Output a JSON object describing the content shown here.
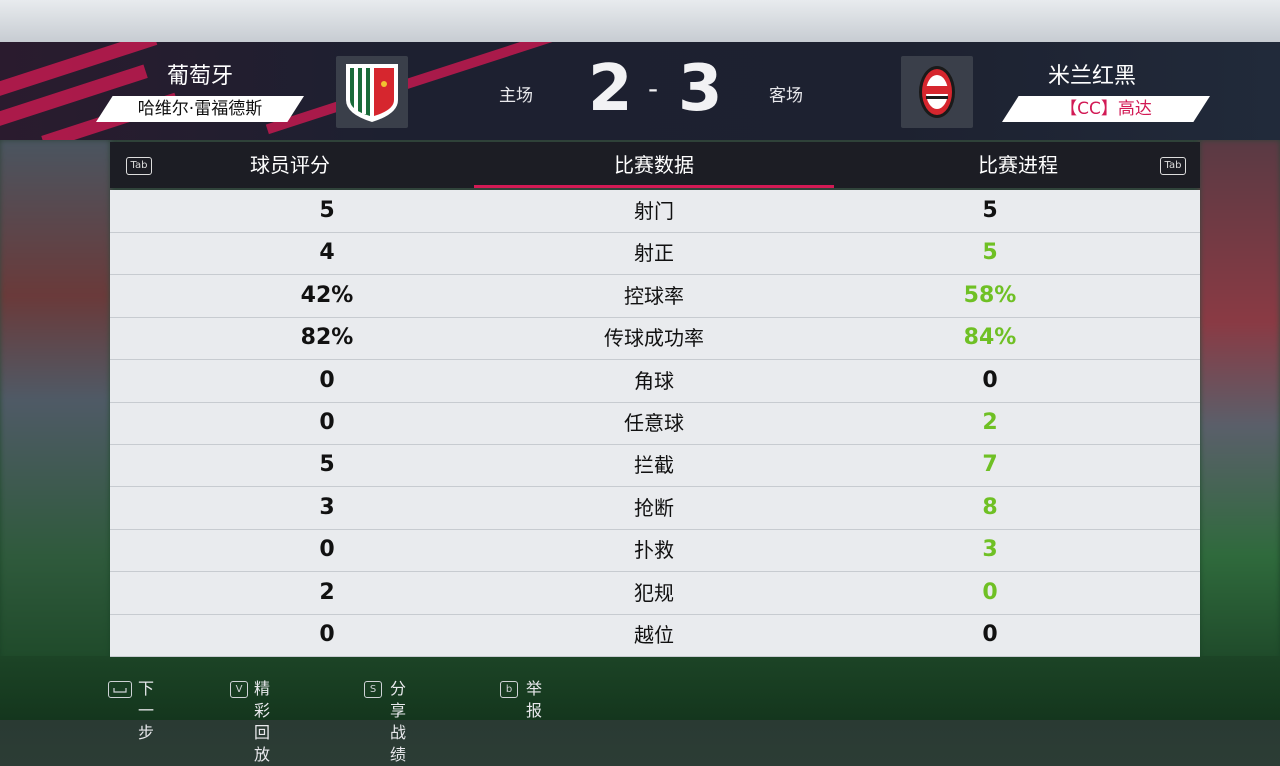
{
  "header": {
    "home_team": "葡萄牙",
    "home_player": "哈维尔·雷福德斯",
    "away_team": "米兰红黑",
    "away_player": "【CC】高达",
    "home_label": "主场",
    "away_label": "客场",
    "home_score": "2",
    "away_score": "3",
    "score_separator": "-"
  },
  "tabs": {
    "left_key": "Tab",
    "right_key": "Tab",
    "items": [
      "球员评分",
      "比赛数据",
      "比赛进程"
    ],
    "active_index": 1
  },
  "stats": [
    {
      "label": "射门",
      "home": "5",
      "away": "5",
      "away_leads": false
    },
    {
      "label": "射正",
      "home": "4",
      "away": "5",
      "away_leads": true
    },
    {
      "label": "控球率",
      "home": "42%",
      "away": "58%",
      "away_leads": true
    },
    {
      "label": "传球成功率",
      "home": "82%",
      "away": "84%",
      "away_leads": true
    },
    {
      "label": "角球",
      "home": "0",
      "away": "0",
      "away_leads": false
    },
    {
      "label": "任意球",
      "home": "0",
      "away": "2",
      "away_leads": true
    },
    {
      "label": "拦截",
      "home": "5",
      "away": "7",
      "away_leads": true
    },
    {
      "label": "抢断",
      "home": "3",
      "away": "8",
      "away_leads": true
    },
    {
      "label": "扑救",
      "home": "0",
      "away": "3",
      "away_leads": true
    },
    {
      "label": "犯规",
      "home": "2",
      "away": "0",
      "away_leads": true
    },
    {
      "label": "越位",
      "home": "0",
      "away": "0",
      "away_leads": false
    }
  ],
  "footer": {
    "items": [
      {
        "key": "",
        "label": "下一步"
      },
      {
        "key": "V",
        "label": "精彩回放"
      },
      {
        "key": "S",
        "label": "分享战绩"
      },
      {
        "key": "b",
        "label": "举报"
      }
    ]
  },
  "colors": {
    "accent": "#d21a55",
    "lead": "#6fc024",
    "table_bg": "#e9ebee",
    "header_bg": "#1d2130"
  },
  "icons": {
    "home_crest": "portugal-crest-icon",
    "away_crest": "milan-crest-icon"
  }
}
